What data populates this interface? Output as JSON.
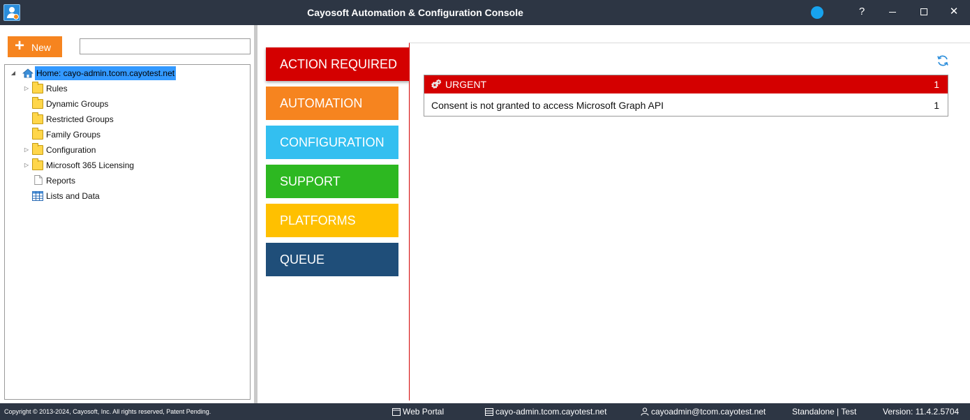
{
  "window": {
    "title": "Cayosoft Automation & Configuration Console",
    "help_label": "?",
    "close_label": "✕"
  },
  "left_panel": {
    "new_button_label": "New",
    "search_value": "",
    "tree": {
      "home": "Home: cayo-admin.tcom.cayotest.net",
      "items": [
        {
          "label": "Rules",
          "icon": "folder-icon",
          "expandable": true
        },
        {
          "label": "Dynamic Groups",
          "icon": "folder-icon",
          "expandable": false
        },
        {
          "label": "Restricted Groups",
          "icon": "folder-icon",
          "expandable": false
        },
        {
          "label": "Family Groups",
          "icon": "folder-icon",
          "expandable": false
        },
        {
          "label": "Configuration",
          "icon": "folder-gear-icon",
          "expandable": true
        },
        {
          "label": "Microsoft 365 Licensing",
          "icon": "folder-icon",
          "expandable": true
        },
        {
          "label": "Reports",
          "icon": "document-icon",
          "expandable": false
        },
        {
          "label": "Lists and Data",
          "icon": "table-icon",
          "expandable": false
        }
      ]
    }
  },
  "tiles": [
    {
      "label": "ACTION REQUIRED",
      "color": "#d40000",
      "active": true
    },
    {
      "label": "AUTOMATION",
      "color": "#f6841f",
      "active": false
    },
    {
      "label": "CONFIGURATION",
      "color": "#33bff0",
      "active": false
    },
    {
      "label": "SUPPORT",
      "color": "#2db821",
      "active": false
    },
    {
      "label": "PLATFORMS",
      "color": "#ffc000",
      "active": false
    },
    {
      "label": "QUEUE",
      "color": "#1f4e79",
      "active": false
    }
  ],
  "urgent": {
    "header": "URGENT",
    "count": "1",
    "rows": [
      {
        "message": "Consent is not granted to access Microsoft Graph API",
        "count": "1"
      }
    ]
  },
  "footer": {
    "copyright": "Copyright © 2013-2024, Cayosoft, Inc. All rights reserved, Patent Pending.",
    "web_portal": "Web Portal",
    "server": "cayo-admin.tcom.cayotest.net",
    "user": "cayoadmin@tcom.cayotest.net",
    "mode": "Standalone | Test",
    "version": "Version: 11.4.2.5704"
  },
  "colors": {
    "titlebar": "#2d3644",
    "accent_blue": "#17a3ee",
    "selection": "#3399ff"
  }
}
